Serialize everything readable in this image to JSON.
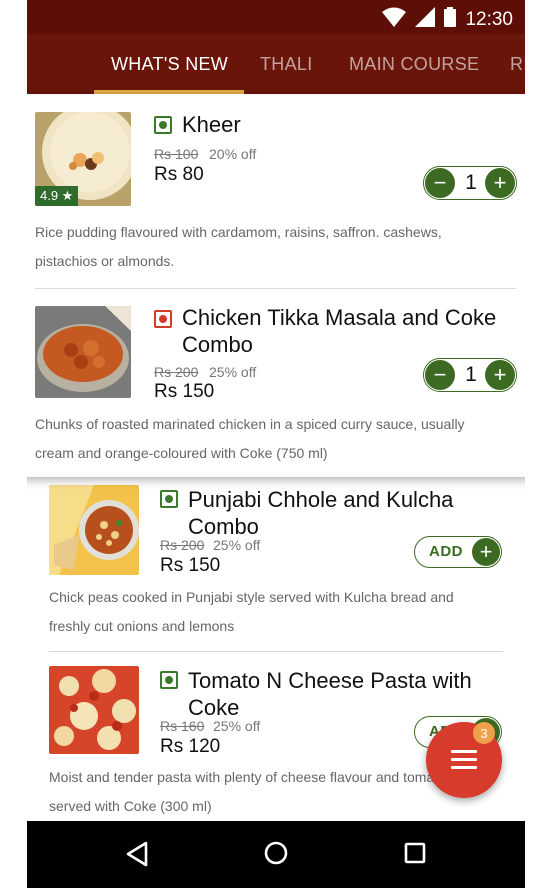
{
  "status_bar": {
    "time": "12:30"
  },
  "tabs": [
    {
      "label": "WHAT'S NEW",
      "active": true
    },
    {
      "label": "THALI",
      "active": false
    },
    {
      "label": "MAIN COURSE",
      "active": false
    },
    {
      "label": "RI",
      "active": false
    }
  ],
  "items": [
    {
      "name": "Kheer",
      "type": "veg",
      "rating": "4.9 ★",
      "old_price": "Rs 100",
      "discount": "20% off",
      "price": "Rs 80",
      "quantity": "1",
      "description_line1": "Rice pudding flavoured with cardamom, raisins, saffron. cashews,",
      "description_line2": "pistachios or almonds."
    },
    {
      "name_line1": "Chicken Tikka Masala and Coke",
      "name_line2": "Combo",
      "type": "non-veg",
      "old_price": "Rs 200",
      "discount": "25% off",
      "price": "Rs 150",
      "quantity": "1",
      "description_line1": "Chunks of roasted marinated chicken in a spiced curry sauce, usually",
      "description_line2": "cream and orange-coloured with Coke (750 ml)"
    },
    {
      "name_line1": "Punjabi Chhole and Kulcha",
      "name_line2": "Combo",
      "type": "veg",
      "old_price": "Rs 200",
      "discount": "25% off",
      "price": "Rs 150",
      "add_label": "ADD",
      "description_line1": "Chick peas cooked in Punjabi style served with Kulcha bread and",
      "description_line2": "freshly cut onions and lemons"
    },
    {
      "name_line1": "Tomato N Cheese Pasta with",
      "name_line2": "Coke",
      "type": "veg",
      "old_price": "Rs 160",
      "discount": "25% off",
      "price": "Rs 120",
      "add_label": "ADD",
      "description_line1": "Moist and tender pasta with plenty of cheese flavour and tomato,",
      "description_line2": "served with Coke (300 ml)"
    }
  ],
  "cart_fab": {
    "badge_count": "3",
    "icon": "menu-icon"
  },
  "nav": {
    "back_icon": "back-icon",
    "home_icon": "home-icon",
    "recents_icon": "recents-icon"
  },
  "colors": {
    "status_bar": "#5c0e07",
    "tab_bar": "#6a1509",
    "tab_indicator": "#e8b24a",
    "veg_green": "#3d6a22",
    "nonveg_red": "#d23a2c",
    "fab_red": "#d63b2c",
    "badge_orange": "#f0a04a"
  }
}
